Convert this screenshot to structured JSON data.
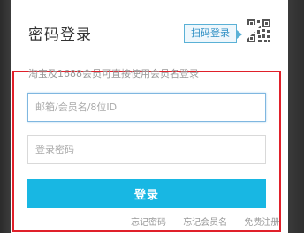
{
  "login": {
    "title": "密码登录",
    "qr_tip": "扫码登录",
    "hint": "淘宝及1688会员可直接使用会员名登录",
    "account_placeholder": "邮箱/会员名/8位ID",
    "password_placeholder": "登录密码",
    "submit_label": "登录",
    "links": [
      {
        "label": "忘记密码"
      },
      {
        "label": "忘记会员名"
      },
      {
        "label": "免费注册"
      }
    ]
  },
  "colors": {
    "accent": "#18b7e3",
    "highlight_frame": "#e0202a",
    "qr_tip_border": "#5ab1d6"
  }
}
